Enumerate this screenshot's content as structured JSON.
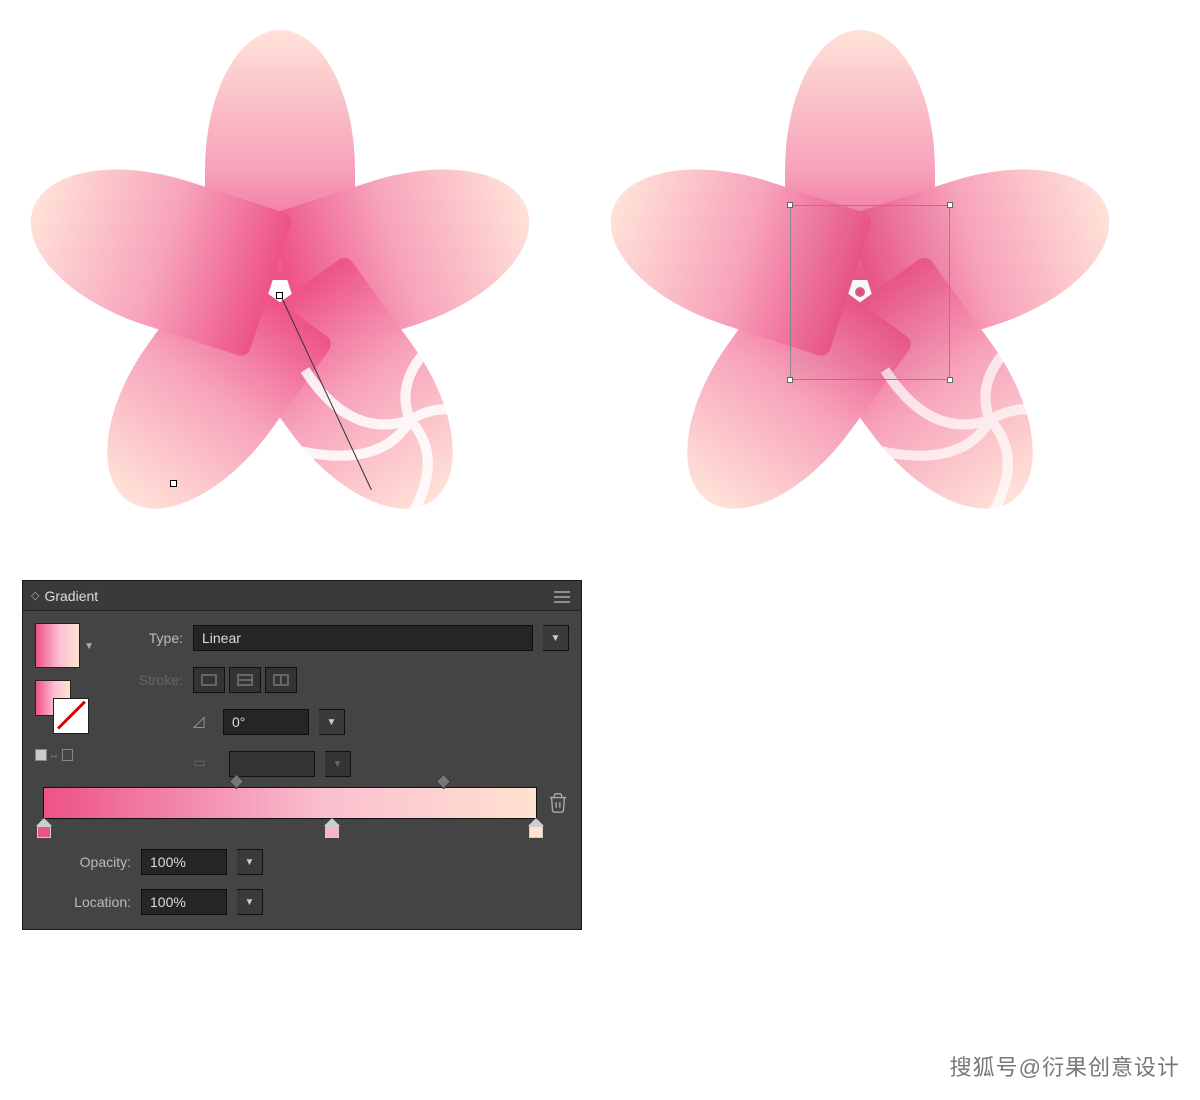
{
  "panel": {
    "title": "Gradient",
    "type_label": "Type:",
    "type_value": "Linear",
    "stroke_label": "Stroke:",
    "angle_value": "0°",
    "opacity_label": "Opacity:",
    "opacity_value": "100%",
    "location_label": "Location:",
    "location_value": "100%"
  },
  "gradient": {
    "stops": [
      {
        "position": 0,
        "color": "#ed5288"
      },
      {
        "position": 57,
        "color": "#f8b4c9"
      },
      {
        "position": 100,
        "color": "#ffe2d0"
      }
    ],
    "midpoints": [
      38,
      80
    ]
  },
  "watermark": "搜狐号@衍果创意设计"
}
